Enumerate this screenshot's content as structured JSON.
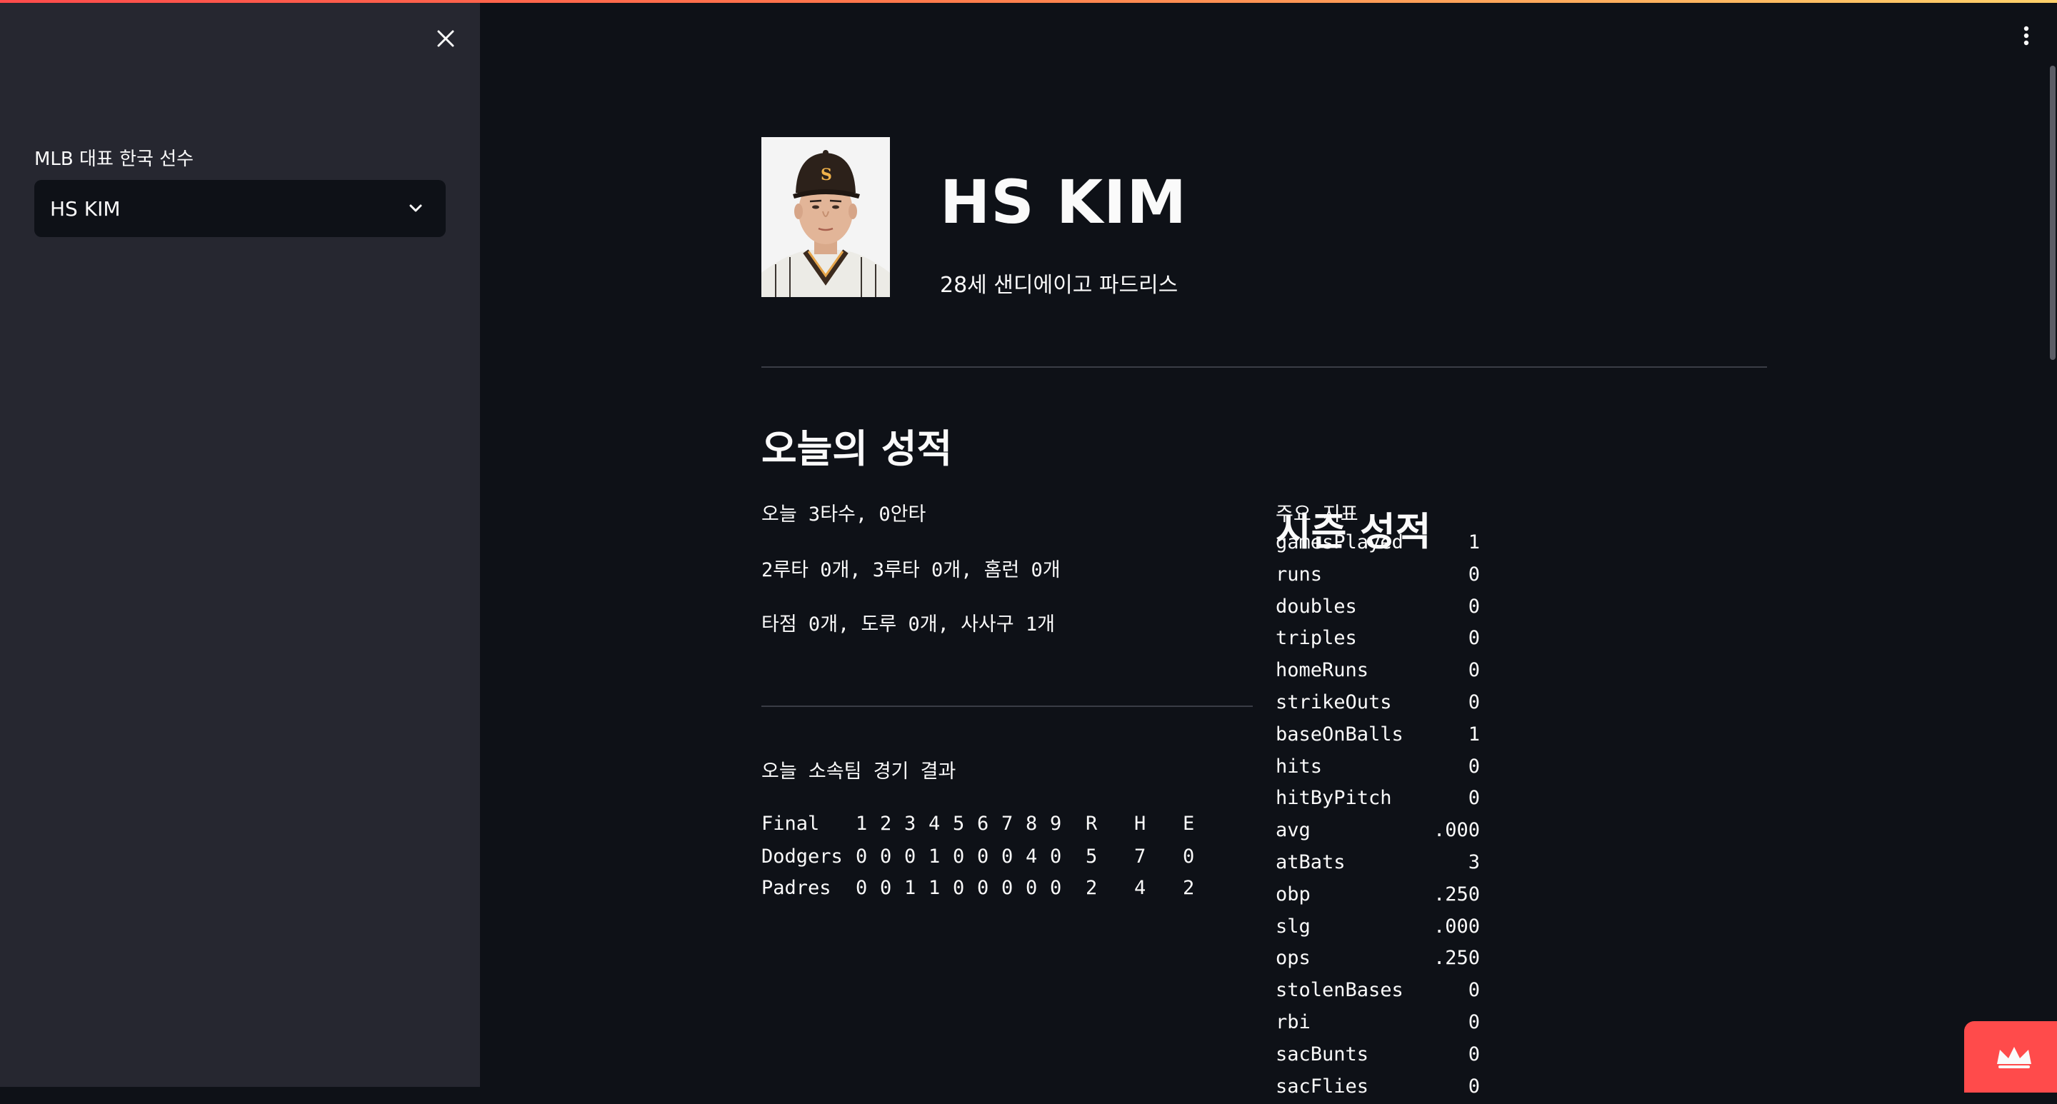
{
  "sidebar": {
    "label": "MLB 대표 한국 선수",
    "selected_player": "HS KIM"
  },
  "player": {
    "name": "HS KIM",
    "subtitle": "28세 샌디에이고 파드리스"
  },
  "today": {
    "title": "오늘의 성적",
    "lines": [
      "오늘 3타수, 0안타",
      "2루타 0개, 3루타 0개, 홈런 0개",
      "타점 0개, 도루 0개, 사사구 1개"
    ]
  },
  "game": {
    "title": "오늘 소속팀 경기 결과",
    "header": [
      "Final",
      "1",
      "2",
      "3",
      "4",
      "5",
      "6",
      "7",
      "8",
      "9",
      "R",
      "H",
      "E"
    ],
    "rows": [
      [
        "Dodgers",
        "0",
        "0",
        "0",
        "1",
        "0",
        "0",
        "0",
        "4",
        "0",
        "5",
        "7",
        "0"
      ],
      [
        "Padres",
        "0",
        "0",
        "1",
        "1",
        "0",
        "0",
        "0",
        "0",
        "0",
        "2",
        "4",
        "2"
      ]
    ]
  },
  "season": {
    "title": "시즌 성적",
    "subtitle": "주요 지표",
    "stats": [
      {
        "key": "gamesPlayed",
        "value": "1"
      },
      {
        "key": "runs",
        "value": "0"
      },
      {
        "key": "doubles",
        "value": "0"
      },
      {
        "key": "triples",
        "value": "0"
      },
      {
        "key": "homeRuns",
        "value": "0"
      },
      {
        "key": "strikeOuts",
        "value": "0"
      },
      {
        "key": "baseOnBalls",
        "value": "1"
      },
      {
        "key": "hits",
        "value": "0"
      },
      {
        "key": "hitByPitch",
        "value": "0"
      },
      {
        "key": "avg",
        "value": ".000"
      },
      {
        "key": "atBats",
        "value": "3"
      },
      {
        "key": "obp",
        "value": ".250"
      },
      {
        "key": "slg",
        "value": ".000"
      },
      {
        "key": "ops",
        "value": ".250"
      },
      {
        "key": "stolenBases",
        "value": "0"
      },
      {
        "key": "rbi",
        "value": "0"
      },
      {
        "key": "sacBunts",
        "value": "0"
      },
      {
        "key": "sacFlies",
        "value": "0"
      }
    ]
  },
  "icons": {
    "close": "close-icon",
    "chevron": "chevron-down-icon",
    "menu": "kebab-menu-icon",
    "crown": "crown-icon"
  },
  "colors": {
    "accent": "#ff4b4b",
    "background": "#0e1117",
    "sidebar": "#262730"
  }
}
